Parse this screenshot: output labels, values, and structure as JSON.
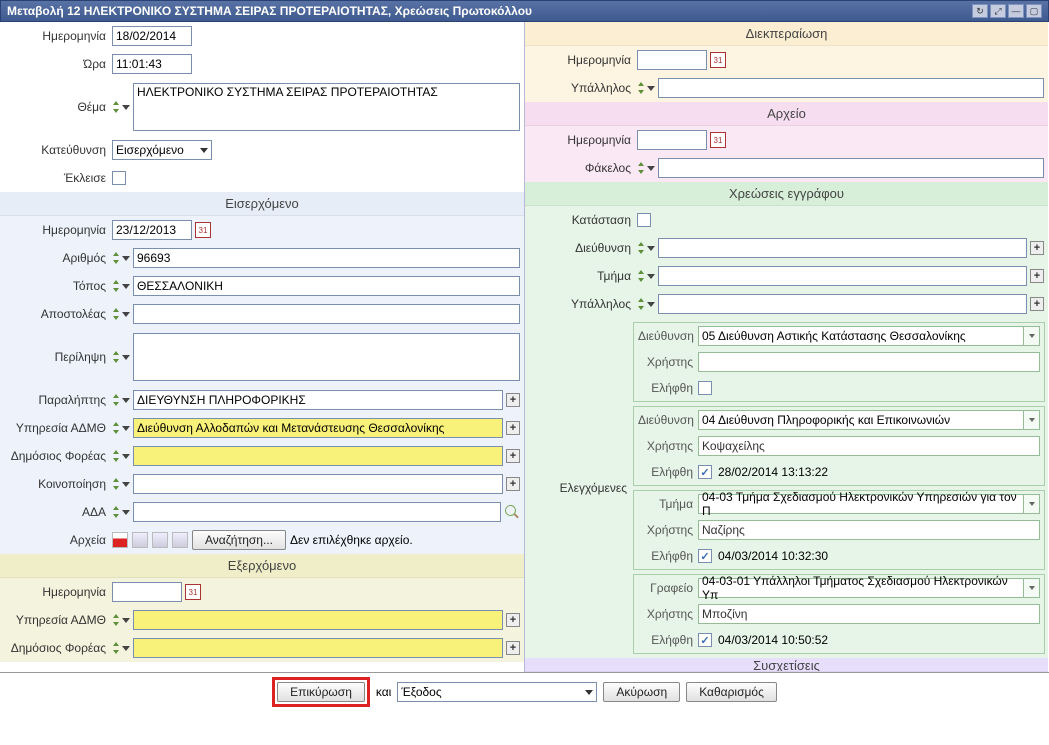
{
  "title": "Μεταβολή 12 ΗΛΕΚΤΡΟΝΙΚΟ ΣΥΣΤΗΜΑ ΣΕΙΡΑΣ ΠΡΟΤΕΡΑΙΟΤΗΤΑΣ, Χρεώσεις Πρωτοκόλλου",
  "left": {
    "date_lbl": "Ημερομηνία",
    "date_val": "18/02/2014",
    "time_lbl": "Ώρα",
    "time_val": "11:01:43",
    "subject_lbl": "Θέμα",
    "subject_val": "ΗΛΕΚΤΡΟΝΙΚΟ ΣΥΣΤΗΜΑ ΣΕΙΡΑΣ ΠΡΟΤΕΡΑΙΟΤΗΤΑΣ",
    "direction_lbl": "Κατεύθυνση",
    "direction_val": "Εισερχόμενο",
    "closed_lbl": "Έκλεισε",
    "incoming_h": "Εισερχόμενο",
    "inc_date_lbl": "Ημερομηνία",
    "inc_date_val": "23/12/2013",
    "num_lbl": "Αριθμός",
    "num_val": "96693",
    "place_lbl": "Τόπος",
    "place_val": "ΘΕΣΣΑΛΟΝΙΚΗ",
    "sender_lbl": "Αποστολέας",
    "sender_val": "",
    "summary_lbl": "Περίληψη",
    "summary_val": "",
    "recipient_lbl": "Παραλήπτης",
    "recipient_val": "ΔΙΕΥΘΥΝΣΗ ΠΛΗΡΟΦΟΡΙΚΗΣ",
    "admth_lbl": "Υπηρεσία ΑΔΜΘ",
    "admth_val": "Διεύθυνση Αλλοδαπών και Μετανάστευσης Θεσσαλονίκης",
    "public_lbl": "Δημόσιος Φορέας",
    "public_val": "",
    "notify_lbl": "Κοινοποίηση",
    "notify_val": "",
    "ada_lbl": "ΑΔΑ",
    "ada_val": "",
    "files_lbl": "Αρχεία",
    "search_btn": "Αναζήτηση...",
    "no_file": "Δεν επιλέχθηκε αρχείο.",
    "outgoing_h": "Εξερχόμενο",
    "out_date_lbl": "Ημερομηνία",
    "out_date_val": "",
    "out_admth_lbl": "Υπηρεσία ΑΔΜΘ",
    "out_admth_val": "",
    "out_public_lbl": "Δημόσιος Φορέας",
    "out_public_val": ""
  },
  "right": {
    "disp_h": "Διεκπεραίωση",
    "disp_date_lbl": "Ημερομηνία",
    "disp_date_val": "",
    "disp_emp_lbl": "Υπάλληλος",
    "disp_emp_val": "",
    "arch_h": "Αρχείο",
    "arch_date_lbl": "Ημερομηνία",
    "arch_date_val": "",
    "arch_folder_lbl": "Φάκελος",
    "arch_folder_val": "",
    "chrg_h": "Χρεώσεις εγγράφου",
    "state_lbl": "Κατάσταση",
    "dir_lbl": "Διεύθυνση",
    "dir_val": "",
    "dept_lbl": "Τμήμα",
    "dept_val": "",
    "emp_lbl": "Υπάλληλος",
    "emp_val": "",
    "checked_lbl": "Ελεγχόμενες",
    "panels": [
      {
        "f1l": "Διεύθυνση",
        "f1v": "05 Διεύθυνση Αστικής Κατάστασης Θεσσαλονίκης",
        "f2l": "Χρήστης",
        "f2v": "",
        "f3l": "Ελήφθη",
        "f3v": "",
        "chk": false,
        "grey": true
      },
      {
        "f1l": "Διεύθυνση",
        "f1v": "04 Διεύθυνση Πληροφορικής και Επικοινωνιών",
        "f2l": "Χρήστης",
        "f2v": "Κοψαχείλης",
        "f3l": "Ελήφθη",
        "f3v": "28/02/2014 13:13:22",
        "chk": true,
        "grey": false
      },
      {
        "f1l": "Τμήμα",
        "f1v": "04-03 Τμήμα Σχεδιασμού Ηλεκτρονικών Υπηρεσιών για τον Π",
        "f2l": "Χρήστης",
        "f2v": "Ναζίρης",
        "f3l": "Ελήφθη",
        "f3v": "04/03/2014 10:32:30",
        "chk": true,
        "grey": false
      },
      {
        "f1l": "Γραφείο",
        "f1v": "04-03-01 Υπάλληλοι Τμήματος Σχεδιασμού Ηλεκτρονικών Υπ",
        "f2l": "Χρήστης",
        "f2v": "Μποζίνη",
        "f3l": "Ελήφθη",
        "f3v": "04/03/2014 10:50:52",
        "chk": true,
        "grey": false
      }
    ],
    "sys_h": "Συσχετίσεις"
  },
  "bottom": {
    "confirm": "Επικύρωση",
    "and": "και",
    "exit": "Έξοδος",
    "cancel": "Ακύρωση",
    "clear": "Καθαρισμός"
  }
}
